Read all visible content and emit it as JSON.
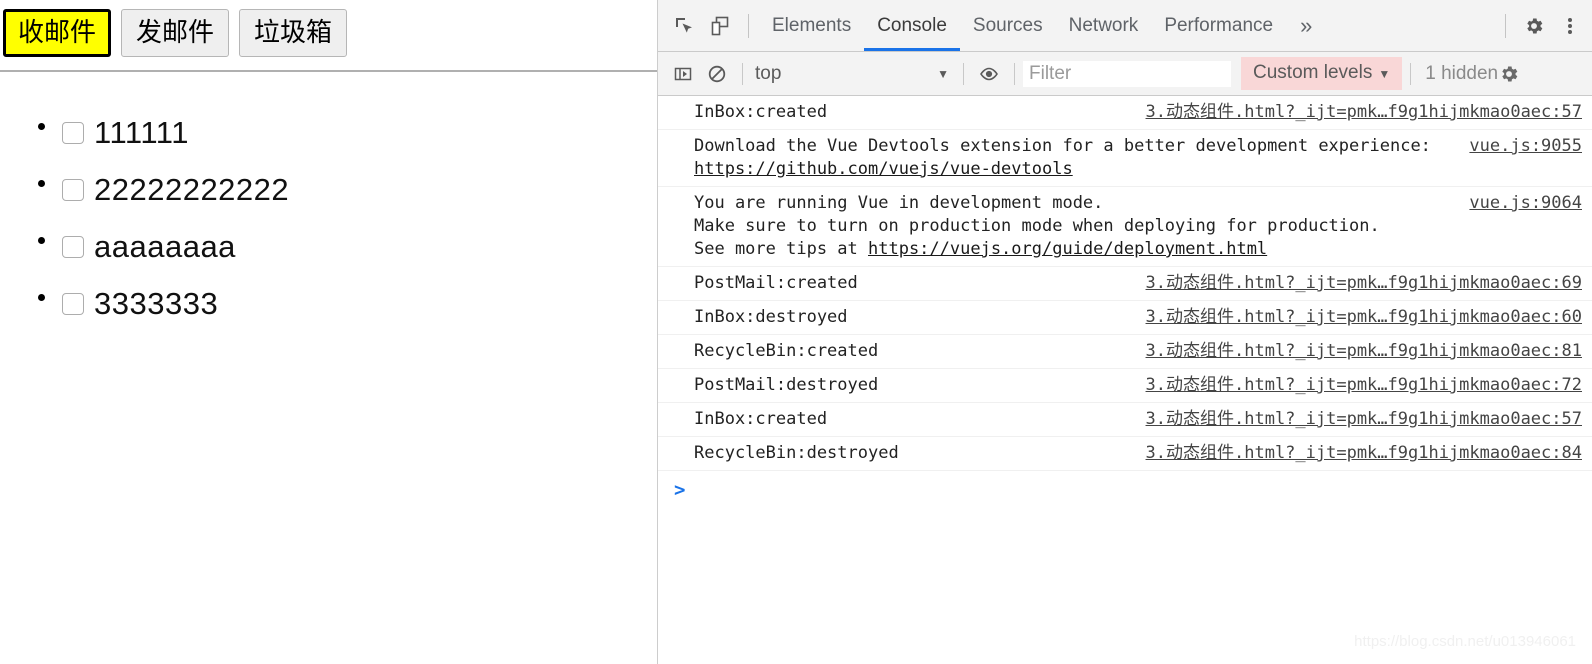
{
  "page": {
    "tabs": [
      {
        "label": "收邮件",
        "active": true
      },
      {
        "label": "发邮件",
        "active": false
      },
      {
        "label": "垃圾箱",
        "active": false
      }
    ],
    "mail_items": [
      {
        "label": "111111",
        "checked": false
      },
      {
        "label": "22222222222",
        "checked": false
      },
      {
        "label": "aaaaaaaa",
        "checked": false
      },
      {
        "label": "3333333",
        "checked": false
      }
    ]
  },
  "devtools": {
    "panel_tabs": [
      {
        "label": "Elements",
        "active": false
      },
      {
        "label": "Console",
        "active": true
      },
      {
        "label": "Sources",
        "active": false
      },
      {
        "label": "Network",
        "active": false
      },
      {
        "label": "Performance",
        "active": false
      }
    ],
    "more_tabs_label": "»",
    "icons": {
      "inspect": "inspect-element-icon",
      "device": "device-toolbar-icon",
      "settings": "gear-icon",
      "menu": "kebab-menu-icon",
      "sidebar": "console-sidebar-icon",
      "clear": "clear-console-icon",
      "eye": "live-expression-icon",
      "right_gear": "console-settings-icon"
    },
    "console_toolbar": {
      "context_label": "top",
      "context_caret": "▼",
      "filter_placeholder": "Filter",
      "filter_value": "",
      "levels_label": "Custom levels",
      "levels_caret": "▼",
      "hidden_label": "1 hidden",
      "levels_bg": "#f9d7d7"
    },
    "accent_color": "#1a73e8",
    "logs": [
      {
        "text": "InBox:created",
        "source": "3.动态组件.html?_ijt=pmk…f9g1hijmkmao0aec:57"
      },
      {
        "text": "Download the Vue Devtools extension for a better development experience: ",
        "link": "https://github.com/vuejs/vue-devtools",
        "source": "vue.js:9055"
      },
      {
        "text": "You are running Vue in development mode.\nMake sure to turn on production mode when deploying for production.\nSee more tips at ",
        "link": "https://vuejs.org/guide/deployment.html",
        "source": "vue.js:9064"
      },
      {
        "text": "PostMail:created",
        "source": "3.动态组件.html?_ijt=pmk…f9g1hijmkmao0aec:69"
      },
      {
        "text": "InBox:destroyed",
        "source": "3.动态组件.html?_ijt=pmk…f9g1hijmkmao0aec:60"
      },
      {
        "text": "RecycleBin:created",
        "source": "3.动态组件.html?_ijt=pmk…f9g1hijmkmao0aec:81"
      },
      {
        "text": "PostMail:destroyed",
        "source": "3.动态组件.html?_ijt=pmk…f9g1hijmkmao0aec:72"
      },
      {
        "text": "InBox:created",
        "source": "3.动态组件.html?_ijt=pmk…f9g1hijmkmao0aec:57"
      },
      {
        "text": "RecycleBin:destroyed",
        "source": "3.动态组件.html?_ijt=pmk…f9g1hijmkmao0aec:84"
      }
    ],
    "prompt_caret": ">",
    "prompt_value": ""
  },
  "watermark": "https://blog.csdn.net/u013946061"
}
